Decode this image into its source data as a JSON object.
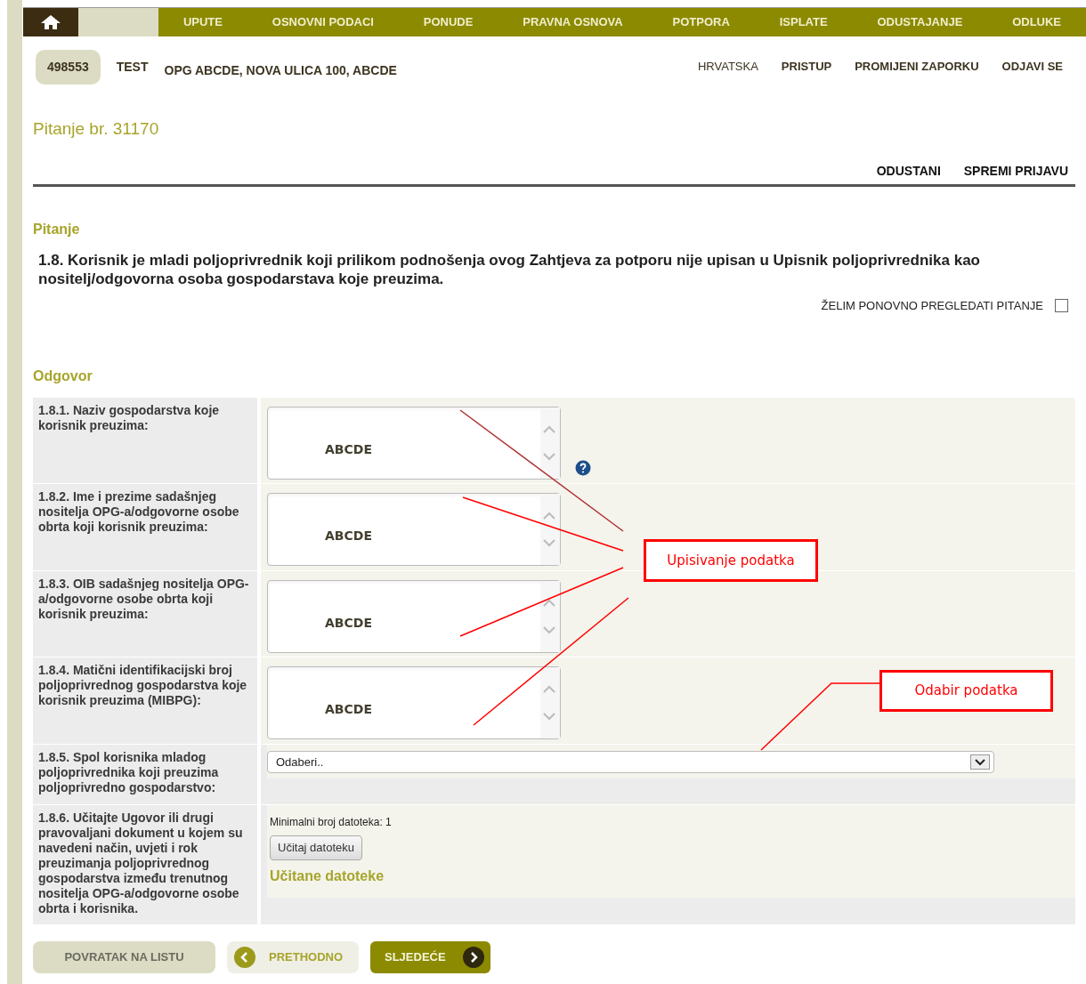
{
  "nav": {
    "items": [
      {
        "label": "UPUTE"
      },
      {
        "label": "OSNOVNI PODACI"
      },
      {
        "label": "PONUDE"
      },
      {
        "label": "PRAVNA OSNOVA"
      },
      {
        "label": "POTPORA"
      },
      {
        "label": "ISPLATE"
      },
      {
        "label": "ODUSTAJANJE"
      },
      {
        "label": "ODLUKE"
      }
    ]
  },
  "header": {
    "user_id": "498553",
    "user_name": "TEST",
    "address": "OPG ABCDE, NOVA ULICA 100, ABCDE",
    "links": [
      "HRVATSKA",
      "PRISTUP",
      "PROMIJENI ZAPORKU",
      "ODJAVI SE"
    ]
  },
  "page_title": "Pitanje br. 31170",
  "actions": [
    "ODUSTANI",
    "SPREMI PRIJAVU"
  ],
  "question": {
    "heading": "Pitanje",
    "text": "1.8. Korisnik je mladi poljoprivrednik koji prilikom podnošenja ovog Zahtjeva za potporu nije upisan u Upisnik poljoprivrednika kao nositelj/odgovorna osoba gospodarstava koje preuzima.",
    "review": {
      "label": "ŽELIM PONOVNO PREGLEDATI PITANJE",
      "checked": false
    }
  },
  "answer": {
    "heading": "Odgovor",
    "rows": [
      {
        "kind": "textarea",
        "label": "1.8.1. Naziv gospodarstva koje korisnik preuzima:",
        "value": "ABCDE",
        "help": true
      },
      {
        "kind": "textarea",
        "label": "1.8.2. Ime i prezime sadašnjeg nositelja OPG-a/odgovorne osobe obrta koji korisnik preuzima:",
        "value": "ABCDE",
        "help": false
      },
      {
        "kind": "textarea",
        "label": "1.8.3. OIB sadašnjeg nositelja OPG-a/odgovorne osobe obrta koji korisnik preuzima:",
        "value": "ABCDE",
        "help": false
      },
      {
        "kind": "textarea",
        "label": "1.8.4. Matični identifikacijski broj poljoprivrednog gospodarstva koje korisnik preuzima (MIBPG):",
        "value": "ABCDE",
        "help": false
      },
      {
        "kind": "select",
        "label": "1.8.5. Spol korisnika mladog poljoprivrednika koji preuzima poljoprivredno gospodarstvo:",
        "value": "Odaberi.."
      },
      {
        "kind": "upload",
        "label": "1.8.6. Učitajte Ugovor ili drugi pravovaljani dokument u kojem su navedeni način, uvjeti i rok preuzimanja poljoprivrednog gospodarstva između trenutnog nositelja OPG-a/odgovorne osobe obrta i korisnika.",
        "min_files": "Minimalni broj datoteka: 1",
        "button": "Učitaj datoteku",
        "files_heading": "Učitane datoteke"
      }
    ]
  },
  "footer_buttons": {
    "back": "POVRATAK NA LISTU",
    "previous": "PRETHODNO",
    "next": "SLJEDEĆE"
  },
  "annotations": [
    {
      "label": "Upisivanje podatka"
    },
    {
      "label": "Odabir podatka"
    }
  ]
}
